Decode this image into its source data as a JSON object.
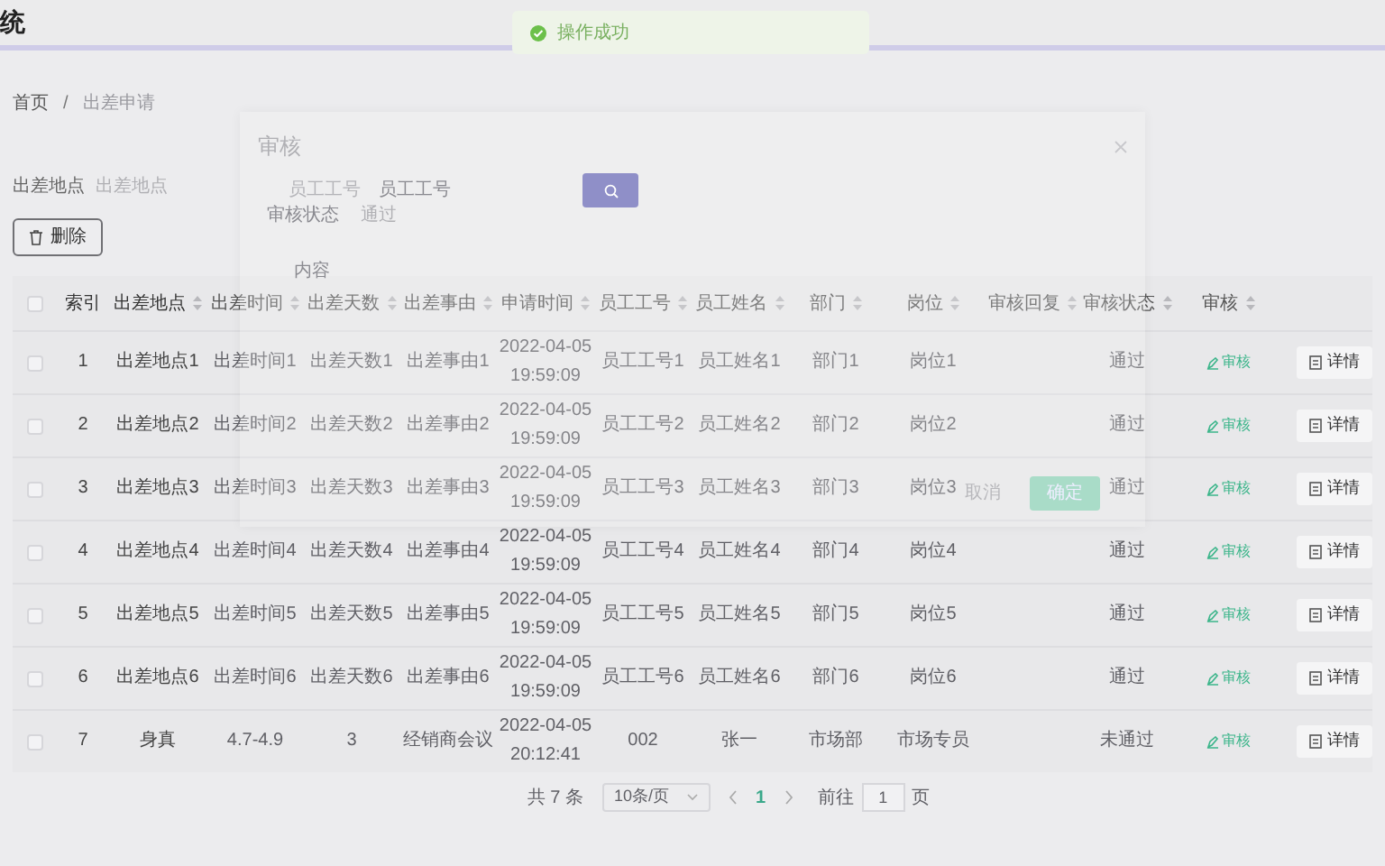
{
  "header": {
    "title": "统"
  },
  "toast": {
    "text": "操作成功"
  },
  "breadcrumb_separator": "/",
  "breadcrumb": [
    {
      "label": "首页",
      "selected": false
    },
    {
      "label": "出差申请",
      "selected": true
    }
  ],
  "filter": {
    "label": "出差地点",
    "placeholder": "出差地点"
  },
  "delete_button": {
    "label": "删除"
  },
  "table": {
    "all_checked": false,
    "columns": [
      {
        "label": "索引",
        "sortable": false
      },
      {
        "label": "出差地点",
        "sortable": true
      },
      {
        "label": "出差时间",
        "sortable": true
      },
      {
        "label": "出差天数",
        "sortable": true
      },
      {
        "label": "出差事由",
        "sortable": true
      },
      {
        "label": "申请时间",
        "sortable": true
      },
      {
        "label": "员工工号",
        "sortable": true
      },
      {
        "label": "员工姓名",
        "sortable": true
      },
      {
        "label": "部门",
        "sortable": true
      },
      {
        "label": "岗位",
        "sortable": true
      },
      {
        "label": "审核回复",
        "sortable": true
      },
      {
        "label": "审核状态",
        "sortable": true
      },
      {
        "label": "审核",
        "sortable": true
      }
    ],
    "rows": [
      {
        "checked": false,
        "cells": [
          "1",
          "出差地点1",
          "出差时间1",
          "出差天数1",
          "出差事由1",
          "2022-04-05\n19:59:09",
          "员工工号1",
          "员工姓名1",
          "部门1",
          "岗位1",
          "",
          "通过"
        ],
        "audit": "审核",
        "detail": "详情"
      },
      {
        "checked": false,
        "cells": [
          "2",
          "出差地点2",
          "出差时间2",
          "出差天数2",
          "出差事由2",
          "2022-04-05\n19:59:09",
          "员工工号2",
          "员工姓名2",
          "部门2",
          "岗位2",
          "",
          "通过"
        ],
        "audit": "审核",
        "detail": "详情"
      },
      {
        "checked": false,
        "cells": [
          "3",
          "出差地点3",
          "出差时间3",
          "出差天数3",
          "出差事由3",
          "2022-04-05\n19:59:09",
          "员工工号3",
          "员工姓名3",
          "部门3",
          "岗位3",
          "",
          "通过"
        ],
        "audit": "审核",
        "detail": "详情"
      },
      {
        "checked": false,
        "cells": [
          "4",
          "出差地点4",
          "出差时间4",
          "出差天数4",
          "出差事由4",
          "2022-04-05\n19:59:09",
          "员工工号4",
          "员工姓名4",
          "部门4",
          "岗位4",
          "",
          "通过"
        ],
        "audit": "审核",
        "detail": "详情"
      },
      {
        "checked": false,
        "cells": [
          "5",
          "出差地点5",
          "出差时间5",
          "出差天数5",
          "出差事由5",
          "2022-04-05\n19:59:09",
          "员工工号5",
          "员工姓名5",
          "部门5",
          "岗位5",
          "",
          "通过"
        ],
        "audit": "审核",
        "detail": "详情"
      },
      {
        "checked": false,
        "cells": [
          "6",
          "出差地点6",
          "出差时间6",
          "出差天数6",
          "出差事由6",
          "2022-04-05\n19:59:09",
          "员工工号6",
          "员工姓名6",
          "部门6",
          "岗位6",
          "",
          "通过"
        ],
        "audit": "审核",
        "detail": "详情"
      },
      {
        "checked": false,
        "cells": [
          "7",
          "身真",
          "4.7-4.9",
          "3",
          "经销商会议",
          "2022-04-05\n20:12:41",
          "002",
          "张一",
          "市场部",
          "市场专员",
          "",
          "未通过"
        ],
        "audit": "审核",
        "detail": "详情"
      }
    ]
  },
  "pagination": {
    "total": "共 7 条",
    "page_size": "10条/页",
    "pages": [
      {
        "label": "1",
        "selected": true
      }
    ],
    "goto_label": "前往",
    "goto_value": "1",
    "goto_suffix": "页"
  },
  "dialog": {
    "title": "审核",
    "field": {
      "label": "员工工号",
      "placeholder": "员工工号"
    },
    "status": {
      "label": "审核状态",
      "value": "通过"
    },
    "content_label": "内容",
    "buttons": [
      {
        "label": "取消",
        "kind": "plain"
      },
      {
        "label": "确定",
        "kind": "primary"
      }
    ]
  }
}
